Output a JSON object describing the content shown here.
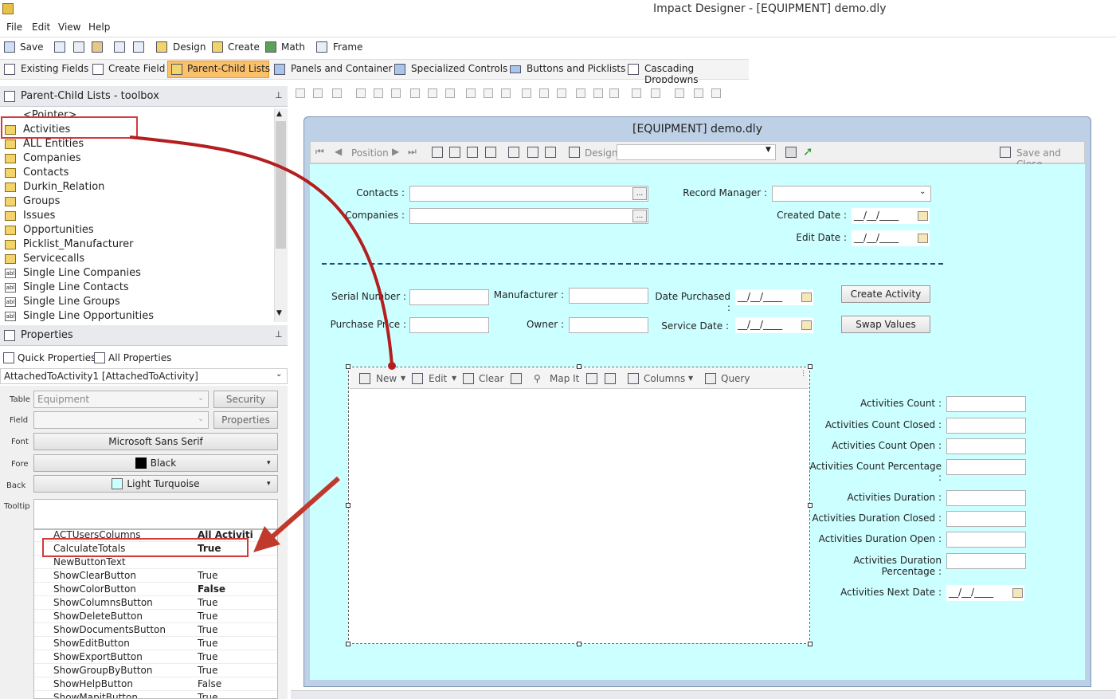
{
  "window": {
    "title": "Impact Designer - [EQUIPMENT] demo.dly"
  },
  "menu": [
    "File",
    "Edit",
    "View",
    "Help"
  ],
  "toolbar": {
    "save": "Save",
    "design": "Design",
    "create": "Create",
    "math": "Math",
    "frame": "Frame"
  },
  "tabs": [
    "Existing Fields",
    "Create Field",
    "Parent-Child Lists",
    "Panels and Container",
    "Specialized Controls",
    "Buttons and Picklists",
    "Cascading Dropdowns"
  ],
  "toolbox": {
    "title": "Parent-Child Lists - toolbox",
    "items": [
      "<Pointer>",
      "Activities",
      "ALL Entities",
      "Companies",
      "Contacts",
      "Durkin_Relation",
      "Groups",
      "Issues",
      "Opportunities",
      "Picklist_Manufacturer",
      "Servicecalls",
      "Single Line Companies",
      "Single Line Contacts",
      "Single Line Groups",
      "Single Line Opportunities"
    ]
  },
  "properties": {
    "title": "Properties",
    "quick_tab": "Quick Properties",
    "all_tab": "All Properties",
    "selected_object": "AttachedToActivity1 [AttachedToActivity]",
    "table_label": "Table",
    "table_value": "Equipment",
    "security_button": "Security",
    "field_label": "Field",
    "properties_button": "Properties",
    "font_label": "Font",
    "font_value": "Microsoft Sans Serif",
    "fore_label": "Fore",
    "fore_value": "Black",
    "back_label": "Back",
    "back_value": "Light Turquoise",
    "tooltip_label": "Tooltip",
    "grid": [
      {
        "key": "ACTUsersColumns",
        "value": "All Activiti"
      },
      {
        "key": "CalculateTotals",
        "value": "True"
      },
      {
        "key": "NewButtonText",
        "value": ""
      },
      {
        "key": "ShowClearButton",
        "value": "True"
      },
      {
        "key": "ShowColorButton",
        "value": "False"
      },
      {
        "key": "ShowColumnsButton",
        "value": "True"
      },
      {
        "key": "ShowDeleteButton",
        "value": "True"
      },
      {
        "key": "ShowDocumentsButton",
        "value": "True"
      },
      {
        "key": "ShowEditButton",
        "value": "True"
      },
      {
        "key": "ShowExportButton",
        "value": "True"
      },
      {
        "key": "ShowGroupByButton",
        "value": "True"
      },
      {
        "key": "ShowHelpButton",
        "value": "False"
      },
      {
        "key": "ShowMapitButton",
        "value": "True"
      }
    ]
  },
  "form": {
    "title": "[EQUIPMENT] demo.dly",
    "position_label": "Position",
    "design_label": "Design",
    "save_close": "Save and Close",
    "contacts": "Contacts :",
    "companies": "Companies :",
    "record_manager": "Record Manager :",
    "created_date": "Created Date :",
    "edit_date": "Edit Date :",
    "date_placeholder": "__/__/____",
    "serial_number": "Serial Number :",
    "manufacturer": "Manufacturer :",
    "date_purchased": "Date Purchased :",
    "purchase_price": "Purchase Price :",
    "owner": "Owner :",
    "service_date": "Service Date :",
    "create_activity": "Create Activity",
    "swap_values": "Swap Values",
    "grid_toolbar": {
      "new": "New",
      "edit": "Edit",
      "clear": "Clear",
      "mapit": "Map It",
      "columns": "Columns",
      "query": "Query"
    },
    "stats": [
      "Activities Count :",
      "Activities Count Closed :",
      "Activities Count Open :",
      "Activities Count Percentage :",
      "Activities Duration :",
      "Activities Duration Closed :",
      "Activities Duration Open :",
      "Activities Duration Percentage :",
      "Activities Next Date :"
    ]
  },
  "colors": {
    "accent_tab": "#fbc06a",
    "form_bg": "#ccffff",
    "annotation": "#c0392b"
  }
}
